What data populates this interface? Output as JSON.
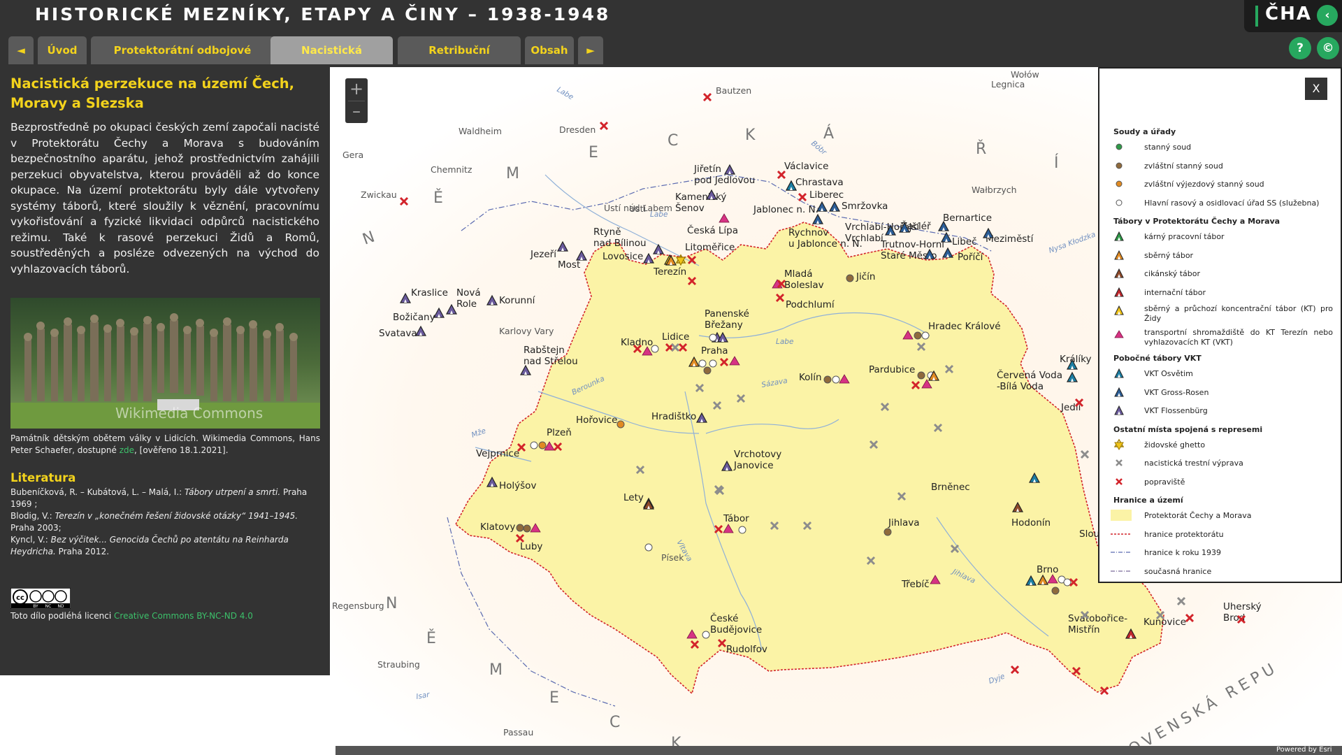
{
  "header": {
    "title": "HISTORICKÉ MEZNÍKY, ETAPY A ČINY – 1938-1948",
    "logo": "ČHA",
    "collapse_icon": "chevron-left-icon"
  },
  "header_buttons": {
    "help": "?",
    "copyright": "©"
  },
  "tabs": [
    {
      "label": "◄"
    },
    {
      "label": "Úvod"
    },
    {
      "label": "Protektorátní odbojové struktury"
    },
    {
      "label": "Nacistická perzekuce",
      "active": true
    },
    {
      "label": "Retribuční soudnictví"
    },
    {
      "label": "Obsah"
    },
    {
      "label": "►"
    }
  ],
  "side": {
    "title": "Nacistická perzekuce na území Čech, Moravy a Slezska",
    "body": "Bezprostředně po okupaci českých zemí započali nacisté v Protektorátu Čechy a Morava s budováním bezpečnostního aparátu, jehož prostřednictvím zahájili perzekuci obyvatelstva, kterou prováděli až do konce okupace. Na území protektorátu byly dále vytvořeny systémy táborů, které sloužily k věznění, pracovnímu vykořisťování a fyzické likvidaci odpůrců nacistického režimu. Také k rasové perzekuci Židů a Romů, soustředěných a posléze odvezených na východ do vyhlazovacích táborů.",
    "photo_watermark": "Wikimedia Commons",
    "caption_a": "Památník dětským obětem války v Lidicích. Wikimedia Commons, Hans Peter Schaefer, dostupné ",
    "caption_link": "zde",
    "caption_b": ", [ověřeno 18.1.2021].",
    "lit_heading": "Literatura",
    "lit": [
      {
        "a": "Bubeníčková, R. – Kubátová, L. – Malá, I.: ",
        "i": "Tábory utrpení a smrti.",
        "b": " Praha 1969 ;"
      },
      {
        "a": "Blodig, V.: ",
        "i": "Terezín v „konečném řešení židovské otázky“ 1941–1945.",
        "b": " Praha 2003;"
      },
      {
        "a": "Kyncl, V.: ",
        "i": "Bez výčitek... Genocida Čechů po atentátu na Reinharda Heydricha.",
        "b": " Praha 2012."
      }
    ],
    "cc_text": [
      "BY",
      "NC",
      "ND"
    ],
    "license_text": "Toto dílo podléhá licenci ",
    "license_link": "Creative Commons BY-NC-ND 4.0"
  },
  "map": {
    "zoom_in": "+",
    "zoom_out": "–",
    "powered": "Powered by Esri",
    "regions": [
      "N",
      "Ě",
      "M",
      "E",
      "C",
      "K",
      "Á",
      "Ř",
      "Í",
      "N",
      "Ě",
      "M",
      "E",
      "C",
      "K",
      "OVENSKÁ REPU"
    ],
    "rivers": [
      "Labe",
      "Labe",
      "Labe",
      "Berounka",
      "Sázava",
      "Vltava",
      "Jihlava",
      "Mže",
      "Nysa Kłodzka",
      "Bóbr",
      "Dyje",
      "Isar"
    ],
    "places_outside": [
      "Bautzen",
      "Dresden",
      "Waldheim",
      "Gera",
      "Chemnitz",
      "Zwickau",
      "Legnica",
      "Wołów",
      "Wałbrzych",
      "Karlovy Vary",
      "Písek",
      "Regensburg",
      "Straubing",
      "Passau",
      "Ústí nad Labem"
    ],
    "places": [
      "Jiřetín pod Jedlovou",
      "Václavice",
      "Chrastava",
      "Liberec",
      "Jablonec n. N.",
      "Smržovka",
      "Kamenický Šenov",
      "Česká Lípa",
      "Rtyně nad Bílinou",
      "Jezeří",
      "Most",
      "Lovosice",
      "Litoměřice",
      "Terezín",
      "Rychnov u Jablonce n. N.",
      "Vrchlabí-Hořejší Vrchlabí",
      "Žacléř",
      "Bernartice",
      "Trutnov-Horní Staré Město",
      "Libeč",
      "Poříčí",
      "Meziměstí",
      "Kraslice",
      "Nová Role",
      "Korunní",
      "Božičany",
      "Svatava",
      "Mladá Boleslav",
      "Jičín",
      "Podchlumí",
      "Panenské Břežany",
      "Kladno",
      "Lidice",
      "Praha",
      "Rabštejn nad Střelou",
      "Hradec Králové",
      "Pardubice",
      "Kolín",
      "Červená Voda-Bílá Voda",
      "Králíky",
      "Jedlí",
      "Hořovice",
      "Hradištko",
      "Plzeň",
      "Vejprnice",
      "Vrchotovy Janovice",
      "Holýšov",
      "Lety",
      "Brněnec",
      "Hodonín",
      "Tábor",
      "Jihlava",
      "Klatovy",
      "Luby",
      "Třebíč",
      "Brno",
      "Sloup",
      "České Budějovice",
      "Rudolfov",
      "Svatobořice-Mistřín",
      "Kunovice",
      "Uherský Brod"
    ]
  },
  "legend": {
    "close": "X",
    "sections": [
      {
        "heading": "Soudy a úřady",
        "items": [
          {
            "label": "stanný soud",
            "symbol": "dot",
            "color": "#2e9a48"
          },
          {
            "label": "zvláštní stanný soud",
            "symbol": "dot",
            "color": "#8f6a3c"
          },
          {
            "label": "zvláštní výjezdový stanný soud",
            "symbol": "dot",
            "color": "#e08a22"
          },
          {
            "label": "Hlavní rasový a osidlovací úřad SS (služebna)",
            "symbol": "ring",
            "color": "#ffffff"
          }
        ]
      },
      {
        "heading": "Tábory v Protektorátu Čechy a Morava",
        "items": [
          {
            "label": "kárný pracovní tábor",
            "symbol": "tent",
            "color": "#2e9a48"
          },
          {
            "label": "sběrný tábor",
            "symbol": "tent",
            "color": "#e08a22"
          },
          {
            "label": "cikánský tábor",
            "symbol": "tent",
            "color": "#8f4a2a"
          },
          {
            "label": "internační tábor",
            "symbol": "tent",
            "color": "#c0272d"
          },
          {
            "label": "sběrný a průchozí koncentrační tábor (KT) pro Židy",
            "symbol": "tent",
            "color": "#f0c419"
          },
          {
            "label": "transportní shromaždiště do KT Terezín nebo vyhlazovacích KT (VKT)",
            "symbol": "triangle",
            "color": "#d63384"
          }
        ]
      },
      {
        "heading": "Pobočné tábory VKT",
        "items": [
          {
            "label": "VKT Osvětim",
            "symbol": "tent",
            "color": "#1c7ea3"
          },
          {
            "label": "VKT Gross-Rosen",
            "symbol": "tent",
            "color": "#2b5d96"
          },
          {
            "label": "VKT Flossenbürg",
            "symbol": "tent",
            "color": "#6a5a9c"
          }
        ]
      },
      {
        "heading": "Ostatní místa spojená s represemi",
        "items": [
          {
            "label": "židovské ghetto",
            "symbol": "star",
            "color": "#f0c419"
          },
          {
            "label": "nacistická trestní výprava",
            "symbol": "cross",
            "color": "#8c8c8c"
          },
          {
            "label": "popraviště",
            "symbol": "cross",
            "color": "#d2232a"
          }
        ]
      },
      {
        "heading": "Hranice a území",
        "items": [
          {
            "label": "Protektorát Čechy a Morava",
            "symbol": "area",
            "color": "#fbf3a6"
          },
          {
            "label": "hranice protektorátu",
            "symbol": "line-red",
            "color": "#d2232a"
          },
          {
            "label": "hranice k roku 1939",
            "symbol": "line-blue",
            "color": "#5a6ab0"
          },
          {
            "label": "současná hranice",
            "symbol": "line-gray",
            "color": "#7a6a9a"
          }
        ]
      }
    ]
  }
}
